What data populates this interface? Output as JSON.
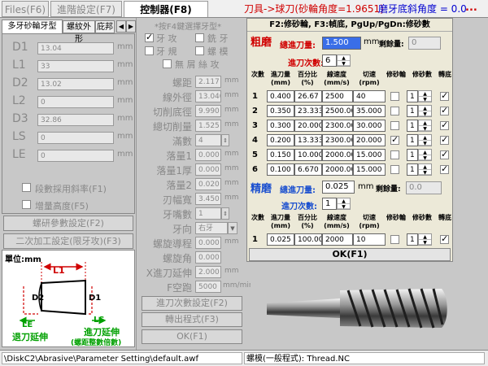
{
  "menu": {
    "tabs": [
      "Files(F6)",
      "進階設定(F7)",
      "控制器(F8)"
    ],
    "msg": "刀具->球刀(砂輪角度=1.9651)",
    "bevel": "磨牙底斜角度 = 0.0",
    "more": "..."
  },
  "left": {
    "tabs": [
      "多牙砂輪牙型",
      "螺紋外形",
      "庇邦"
    ],
    "tab_arrows": [
      "◀",
      "▶"
    ],
    "params": [
      {
        "label": "D1",
        "value": "13.04",
        "unit": "mm"
      },
      {
        "label": "L1",
        "value": "33",
        "unit": "mm"
      },
      {
        "label": "D2",
        "value": "13.02",
        "unit": "mm"
      },
      {
        "label": "L2",
        "value": "0",
        "unit": "mm"
      },
      {
        "label": "D3",
        "value": "32.86",
        "unit": "mm"
      },
      {
        "label": "LS",
        "value": "0",
        "unit": "mm"
      },
      {
        "label": "LE",
        "value": "0",
        "unit": "mm"
      }
    ],
    "chk_slope": "段數採用斜率(F1)",
    "chk_height": "增量高度(F5)",
    "btn_params": "螺研參數設定(F2)",
    "btn_second": "二次加工設定(限牙攻)(F3)",
    "unit_label": "單位:mm",
    "dg": {
      "l1": "L1",
      "d2": "D2",
      "d1": "D1",
      "le": "LE",
      "ls": "LS",
      "retract": "退刀延伸",
      "feed": "進刀延伸",
      "feed_note": "(螺距整數倍數)"
    }
  },
  "mid": {
    "title": "*按F4鍵選擇牙型*",
    "types": [
      "牙 攻",
      "銑 牙",
      "牙 規",
      "螺 模"
    ],
    "no_chip": "無 屑 絲 攻",
    "rows": [
      {
        "label": "螺距",
        "value": "2.117",
        "unit": "mm"
      },
      {
        "label": "線外徑",
        "value": "13.040",
        "unit": "mm"
      },
      {
        "label": "切削底徑",
        "value": "9.990",
        "unit": "mm"
      },
      {
        "label": "總切削量",
        "value": "1.525",
        "unit": "mm"
      },
      {
        "label": "滿數",
        "value": "4",
        "unit": ""
      },
      {
        "label": "落量1",
        "value": "0.000",
        "unit": "mm"
      },
      {
        "label": "落量1厚",
        "value": "0.000",
        "unit": "mm"
      },
      {
        "label": "落量2",
        "value": "0.020",
        "unit": "mm"
      },
      {
        "label": "刃幅寬",
        "value": "3.450",
        "unit": "mm"
      },
      {
        "label": "牙嘴數",
        "value": "1",
        "unit": ""
      },
      {
        "label": "牙向",
        "value": "右牙",
        "unit": ""
      },
      {
        "label": "螺旋導程",
        "value": "0.000",
        "unit": "mm"
      },
      {
        "label": "螺旋角",
        "value": "0.000",
        "unit": ""
      },
      {
        "label": "X進刀延伸",
        "value": "2.000",
        "unit": "mm"
      },
      {
        "label": "F空跑",
        "value": "5000",
        "unit": "mm/min"
      }
    ],
    "btn_feed": "進刀次數設定(F2)",
    "btn_transfer": "轉出程式(F3)",
    "btn_ok": "OK(F1)"
  },
  "dialog": {
    "header": "F2:修砂輪, F3:幀底, PgUp/PgDn:修砂數",
    "rough": {
      "title": "粗磨",
      "total_label": "總進刀量:",
      "total_value": "1.500",
      "unit": "mm",
      "remain_label": "剩餘量:",
      "remain_value": "0",
      "count_label": "進刀次數:",
      "count_value": "6"
    },
    "cols": [
      "次數",
      "進刀量 (mm)",
      "百分比 (%)",
      "線速度 (mm/s)",
      "切速 (rpm)",
      "修砂輪",
      "修砂數",
      "轉底"
    ],
    "rows": [
      {
        "n": "1",
        "feed": "0.400",
        "pct": "26.67",
        "spd": "2500",
        "cut": "40",
        "dress": false,
        "cnt": "1",
        "base": true
      },
      {
        "n": "2",
        "feed": "0.350",
        "pct": "23.333",
        "spd": "2500.00",
        "cut": "35.000",
        "dress": false,
        "cnt": "1",
        "base": true
      },
      {
        "n": "3",
        "feed": "0.300",
        "pct": "20.000",
        "spd": "2300.00",
        "cut": "30.000",
        "dress": false,
        "cnt": "1",
        "base": true
      },
      {
        "n": "4",
        "feed": "0.200",
        "pct": "13.333",
        "spd": "2300.00",
        "cut": "20.000",
        "dress": true,
        "cnt": "1",
        "base": true
      },
      {
        "n": "5",
        "feed": "0.150",
        "pct": "10.000",
        "spd": "2000.00",
        "cut": "15.000",
        "dress": false,
        "cnt": "1",
        "base": true
      },
      {
        "n": "6",
        "feed": "0.100",
        "pct": "6.670",
        "spd": "2000.00",
        "cut": "15.000",
        "dress": false,
        "cnt": "1",
        "base": true
      }
    ],
    "fine": {
      "title": "精磨",
      "total_label": "總進刀量:",
      "total_value": "0.025",
      "unit": "mm",
      "remain_label": "剩餘量:",
      "remain_value": "0.0",
      "count_label": "進刀次數:",
      "count_value": "1"
    },
    "fine_rows": [
      {
        "n": "1",
        "feed": "0.025",
        "pct": "100.00",
        "spd": "2000",
        "cut": "10",
        "dress": false,
        "cnt": "1",
        "base": true
      }
    ],
    "ok": "OK(F1)"
  },
  "status": {
    "path": "\\DiskC2\\Abrasive\\Parameter Setting\\default.awf",
    "file": "螺模(一般程式): Thread.NC"
  }
}
